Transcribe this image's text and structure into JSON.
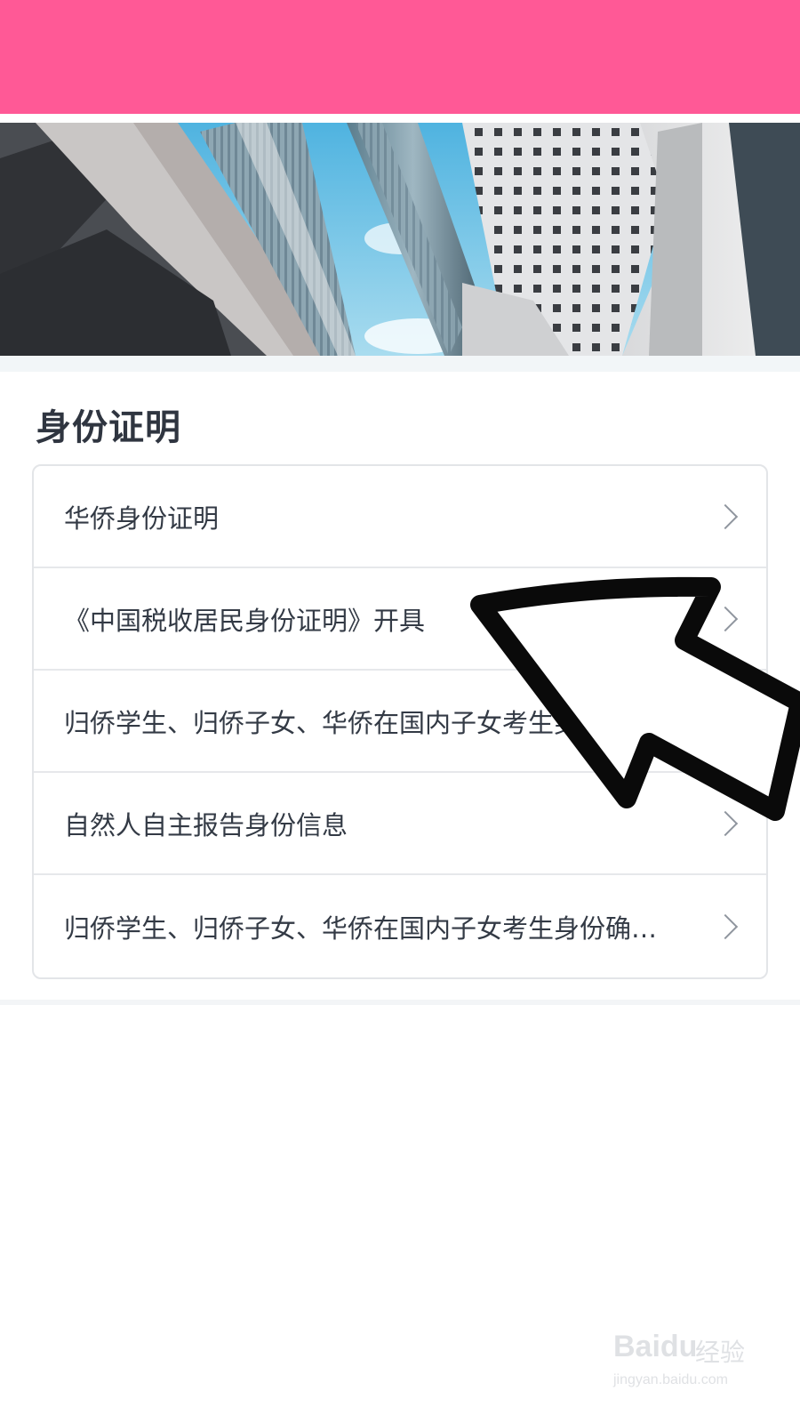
{
  "colors": {
    "header": "#ff5996",
    "title": "#2f3540",
    "item_text": "#333a45",
    "chevron": "#8f959e",
    "border": "#e3e5e8"
  },
  "section": {
    "title": "身份证明",
    "items": [
      {
        "label": "华侨身份证明",
        "icon": "chevron-right-icon"
      },
      {
        "label": "《中国税收居民身份证明》开具",
        "icon": "chevron-right-icon"
      },
      {
        "label": "归侨学生、归侨子女、华侨在国内子女考生身份确…",
        "icon": "chevron-right-icon"
      },
      {
        "label": "自然人自主报告身份信息",
        "icon": "chevron-right-icon"
      },
      {
        "label": "归侨学生、归侨子女、华侨在国内子女考生身份确…",
        "icon": "chevron-right-icon"
      }
    ]
  },
  "watermark": {
    "brand": "Baidu",
    "cn": "经验",
    "url": "jingyan.baidu.com"
  }
}
